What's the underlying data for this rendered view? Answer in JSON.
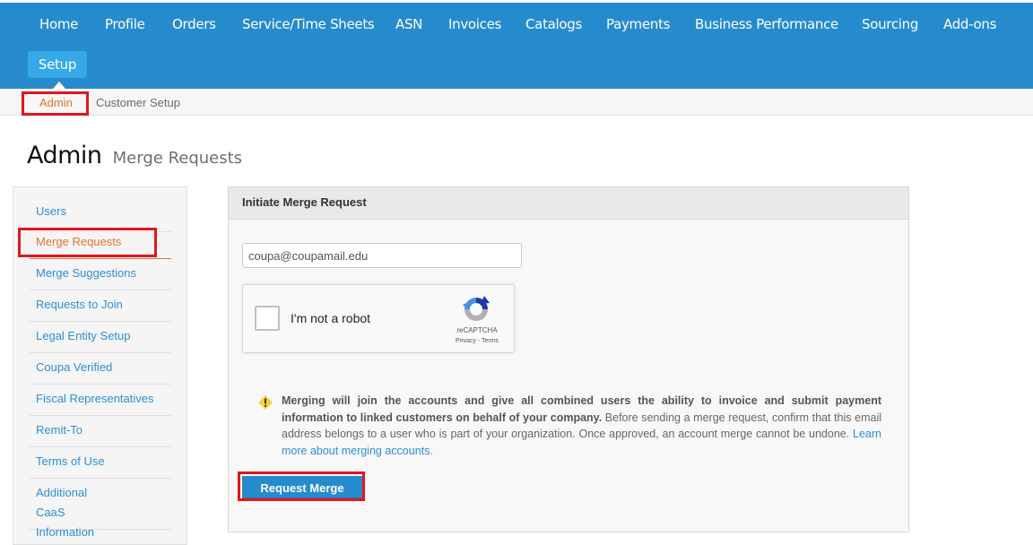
{
  "topnav": {
    "items": [
      {
        "label": "Home"
      },
      {
        "label": "Profile"
      },
      {
        "label": "Orders"
      },
      {
        "label": "Service/Time Sheets"
      },
      {
        "label": "ASN"
      },
      {
        "label": "Invoices"
      },
      {
        "label": "Catalogs"
      },
      {
        "label": "Payments"
      },
      {
        "label": "Business Performance"
      },
      {
        "label": "Sourcing"
      },
      {
        "label": "Add-ons"
      }
    ],
    "setup_label": "Setup"
  },
  "subnav": {
    "admin_label": "Admin",
    "customer_setup_label": "Customer Setup"
  },
  "page": {
    "title": "Admin",
    "subtitle": "Merge Requests"
  },
  "sidebar": {
    "items": [
      {
        "label": "Users"
      },
      {
        "label": "Merge Requests",
        "active": true
      },
      {
        "label": "Merge Suggestions"
      },
      {
        "label": "Requests to Join"
      },
      {
        "label": "Legal Entity Setup"
      },
      {
        "label": "Coupa Verified"
      },
      {
        "label": "Fiscal Representatives"
      },
      {
        "label": "Remit-To"
      },
      {
        "label": "Terms of Use"
      },
      {
        "label": "Additional CaaS Information"
      }
    ]
  },
  "panel": {
    "header": "Initiate Merge Request",
    "email_value": "coupa@coupamail.edu",
    "captcha": {
      "label": "I'm not a robot",
      "brand": "reCAPTCHA",
      "links": "Privacy - Terms"
    },
    "info_bold": "Merging will join the accounts and give all combined users the ability to invoice and submit payment information to linked customers on behalf of your company.",
    "info_text": " Before sending a merge request, confirm that this email address belongs to a user who is part of your organization. Once approved, an account merge cannot be undone. ",
    "info_link": "Learn more about merging accounts.",
    "button_label": "Request Merge"
  },
  "colors": {
    "nav_blue": "#268bcd",
    "active_orange": "#e8732b",
    "link_blue": "#2b8fd2",
    "highlight_red": "#e3151f"
  }
}
